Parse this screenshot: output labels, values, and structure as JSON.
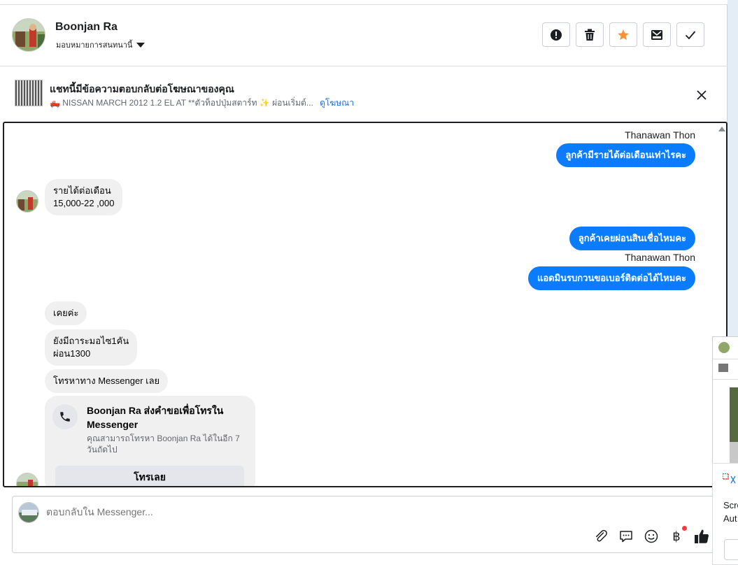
{
  "header": {
    "contact_name": "Boonjan Ra",
    "assign_label": "มอบหมายการสนทนานี้",
    "actions": [
      "report-icon",
      "trash-icon",
      "star-icon",
      "mark-unread-icon",
      "check-icon"
    ],
    "star_color": "#f7923b"
  },
  "ad": {
    "title": "แชทนี้มีข้อความตอบกลับต่อโฆษณาของคุณ",
    "subtitle": "🛻 NISSAN MARCH 2012 1.2 EL AT **ตัวท็อปปุ่มสตาร์ท ✨ ผ่อนเริ่มต์...",
    "link": "ดูโฆษณา"
  },
  "messages": {
    "sender1": "Thanawan Thon",
    "out1": "ลูกค้ามีรายได้ต่อเดือนเท่าไรคะ",
    "in1_line1": "รายได้ต่อเดือน",
    "in1_line2": "15,000-22 ,000",
    "out2": "ลูกค้าเคยผ่อนสินเชื่อไหมคะ",
    "sender2": "Thanawan Thon",
    "out3": "แอดมินรบกวนขอเบอร์ติดต่อได้ไหมคะ",
    "in2": "เคยค่ะ",
    "in3_line1": "ยังมีถาระมอไซ1คัน",
    "in3_line2": "ผ่อน1300",
    "in4": "โทรหาทาง Messenger เลย",
    "call_title": "Boonjan Ra ส่งคำขอเพื่อโทรใน Messenger",
    "call_desc": "คุณสามารถโทรหา Boonjan Ra ได้ในอีก 7 วันถัดไป",
    "call_button": "โทรเลย"
  },
  "composer": {
    "placeholder": "ตอบกลับใน Messenger...",
    "tools": [
      "attach-icon",
      "saved-reply-icon",
      "emoji-icon",
      "baht-icon",
      "like-icon"
    ],
    "accent": "#0a7cff"
  },
  "side_popup": {
    "line1": "Scre",
    "line2": "Aut"
  }
}
